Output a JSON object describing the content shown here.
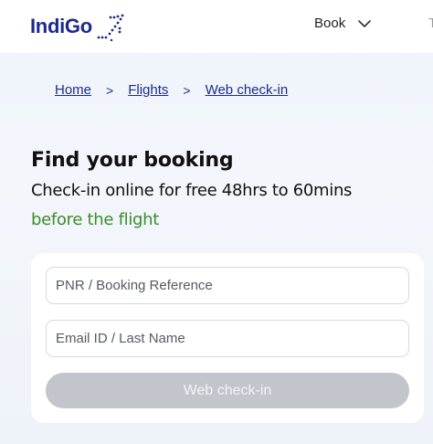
{
  "header": {
    "logo_text": "IndiGo",
    "nav_book_label": "Book",
    "nav_cut_label": "T"
  },
  "breadcrumb": {
    "items": [
      "Home",
      "Flights",
      "Web check-in"
    ],
    "separator": ">"
  },
  "main": {
    "title": "Find your booking",
    "subtitle_line1": "Check-in online for free 48hrs to 60mins",
    "subtitle_line2": "before the flight"
  },
  "form": {
    "pnr_placeholder": "PNR / Booking Reference",
    "email_placeholder": "Email ID / Last Name",
    "submit_label": "Web check-in"
  },
  "colors": {
    "brand": "#1e2a8a",
    "accent_green": "#3d8b2a",
    "disabled_button": "#c2c5cc"
  },
  "icons": [
    "plane-dots-logo-icon",
    "chevron-down-icon",
    "chevron-right-icon"
  ]
}
